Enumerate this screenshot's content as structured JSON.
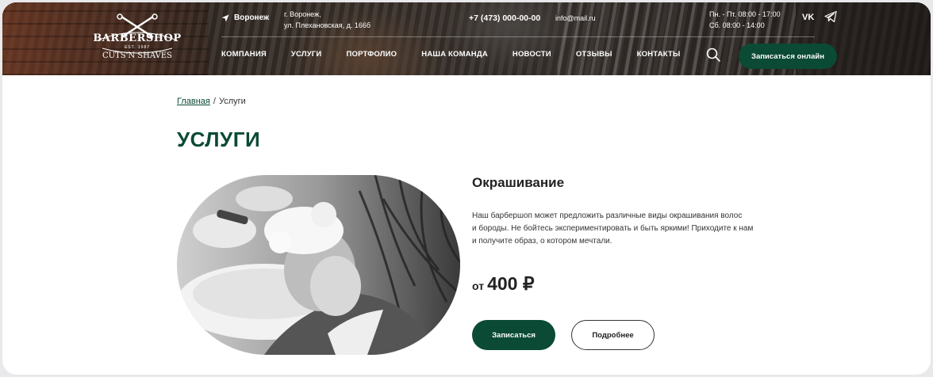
{
  "header": {
    "logo": {
      "main": "BARBERSHOP",
      "est": "EST. 1987",
      "sub": "CUTS'N SHAVES"
    },
    "city": "Воронеж",
    "address_line1": "г. Воронеж,",
    "address_line2": "ул. Плехановская, д. 166б",
    "phone": "+7 (473) 000-00-00",
    "email": "info@mail.ru",
    "hours_line1": "Пн. - Пт. 08:00 - 17:00",
    "hours_line2": "Сб. 08:00 - 14:00",
    "social": {
      "vk": "VK",
      "telegram_icon": "telegram-icon"
    },
    "nav": [
      "КОМПАНИЯ",
      "УСЛУГИ",
      "ПОРТФОЛИО",
      "НАША КОМАНДА",
      "НОВОСТИ",
      "ОТЗЫВЫ",
      "КОНТАКТЫ"
    ],
    "search_icon": "search-icon",
    "cta": "Записаться онлайн"
  },
  "breadcrumb": {
    "home": "Главная",
    "separator": "/",
    "current": "Услуги"
  },
  "page": {
    "title": "УСЛУГИ"
  },
  "service": {
    "title": "Окрашивание",
    "description_lines": [
      "Наш барбершоп может предложить различные виды окрашивания волос",
      "и бороды. Не бойтесь экспериментировать и быть яркими! Приходите к нам",
      "и получите образ, о котором мечтали."
    ],
    "price_from": "от",
    "price_value": "400 ₽",
    "book_button": "Записаться",
    "more_button": "Подробнее"
  },
  "colors": {
    "accent": "#0b4a35",
    "background": "#ffffff"
  }
}
